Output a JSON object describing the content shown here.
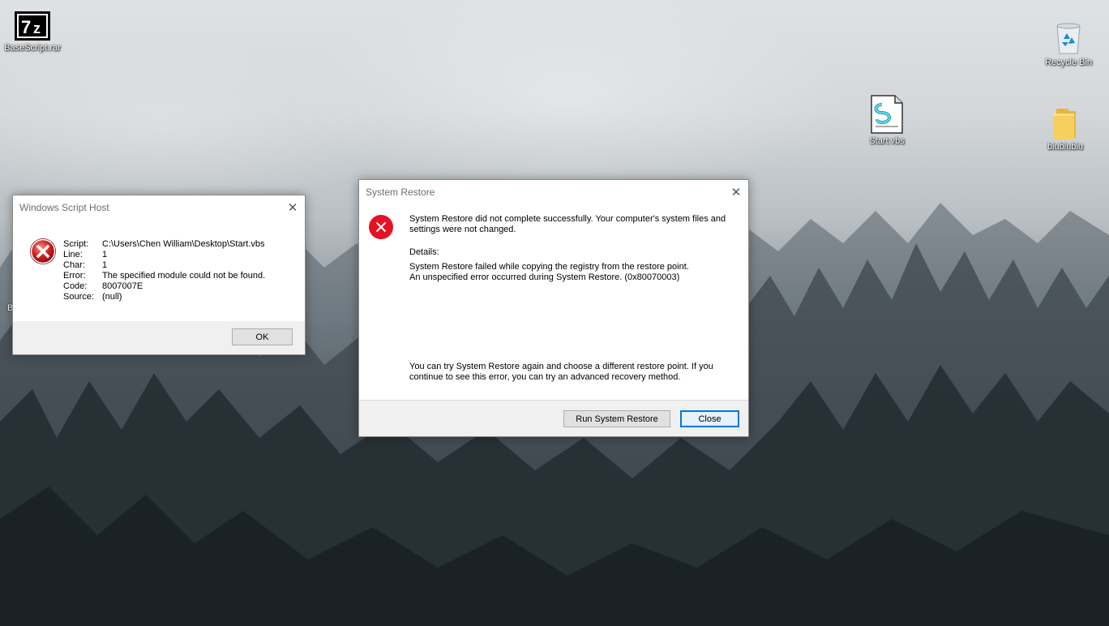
{
  "desktop": {
    "icons": [
      {
        "label": "BaseScript.rar",
        "icon": "7zip-archive-icon"
      },
      {
        "label": "Recycle Bin",
        "icon": "recycle-bin-icon"
      },
      {
        "label": "Start.vbs",
        "icon": "vbscript-file-icon"
      },
      {
        "label": "biubiubiu",
        "icon": "folder-icon"
      }
    ],
    "obscured_label_fragment": "B"
  },
  "wsh_dialog": {
    "title": "Windows Script Host",
    "close_glyph": "✕",
    "rows": [
      {
        "key": "Script:",
        "value": "C:\\Users\\Chen William\\Desktop\\Start.vbs"
      },
      {
        "key": "Line:",
        "value": "1"
      },
      {
        "key": "Char:",
        "value": "1"
      },
      {
        "key": "Error:",
        "value": "The specified module could not be found."
      },
      {
        "key": "Code:",
        "value": "8007007E"
      },
      {
        "key": "Source:",
        "value": "(null)"
      }
    ],
    "ok_label": "OK"
  },
  "sr_dialog": {
    "title": "System Restore",
    "close_glyph": "✕",
    "message_line1": "System Restore did not complete successfully. Your computer's system files and",
    "message_line2": "settings were not changed.",
    "details_heading": "Details:",
    "details_line1": "System Restore failed while copying the registry from the restore point.",
    "details_line2": "An unspecified error occurred during System Restore. (0x80070003)",
    "advice_line1": "You can try System Restore again and choose a different restore point. If you",
    "advice_line2": "continue to see this error, you can try an advanced recovery method.",
    "run_label": "Run System Restore",
    "close_label": "Close"
  },
  "colors": {
    "error_red": "#e81123",
    "focus_blue": "#0078d7"
  }
}
